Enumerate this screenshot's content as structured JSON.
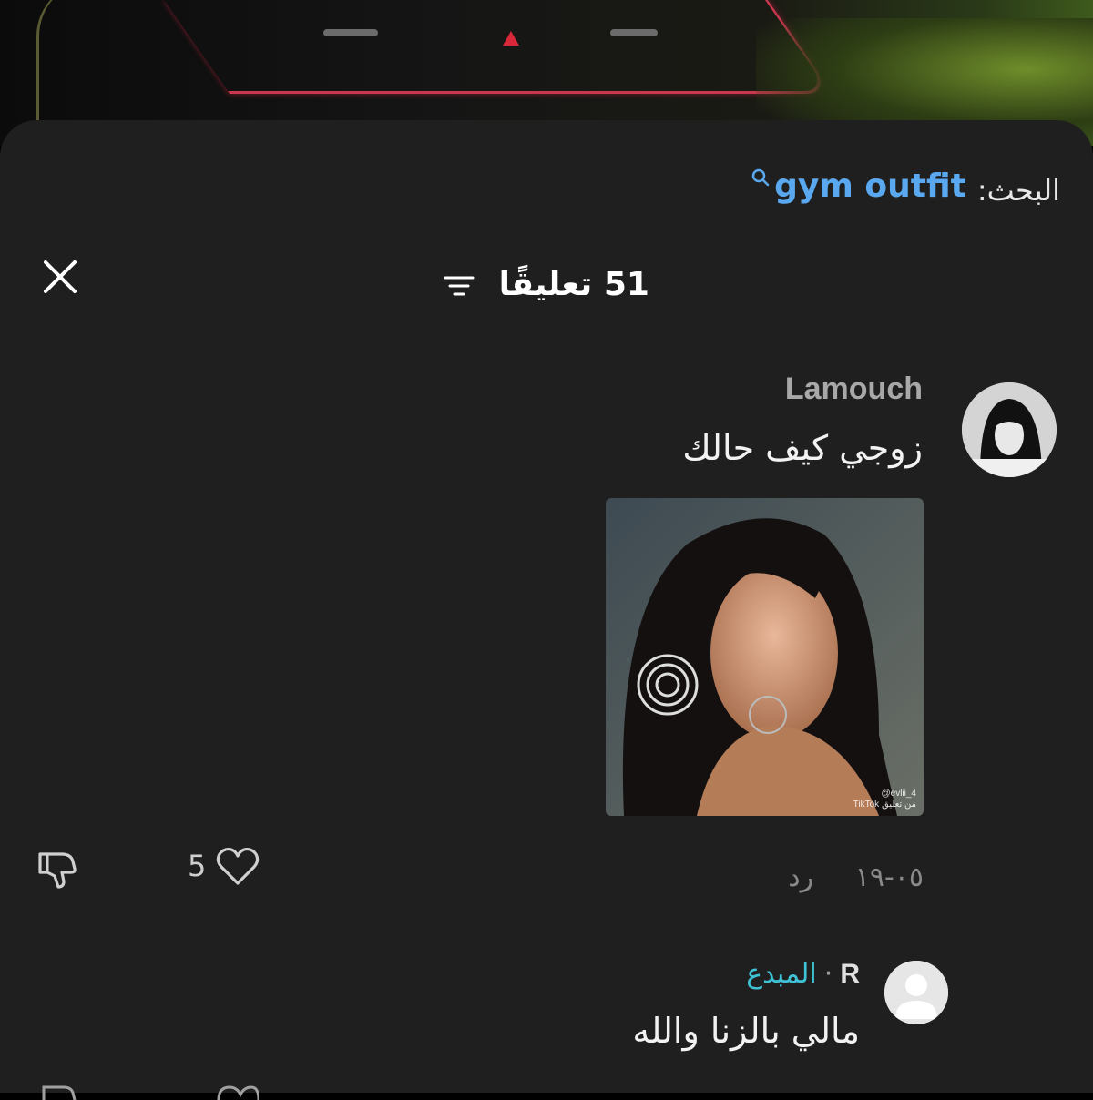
{
  "search": {
    "prefix": "البحث:",
    "query": "gym outfit"
  },
  "header": {
    "comment_count_label": "51 تعليقًا"
  },
  "comments": [
    {
      "username": "Lamouch",
      "text": "زوجي كيف حالك",
      "date": "٠٥-١٩",
      "reply_label": "رد",
      "likes": "5",
      "photo_watermark": "@evlii_4",
      "photo_watermark_2": "TikTok من تعليق"
    }
  ],
  "reply": {
    "username": "R",
    "badge": "المبدع",
    "text": "مالي بالزنا والله"
  },
  "colors": {
    "sheet_bg": "#1f1f1f",
    "search_query": "#5aa9f0",
    "creator_badge": "#3fc2d6",
    "muted_text": "#8a8a8a"
  }
}
